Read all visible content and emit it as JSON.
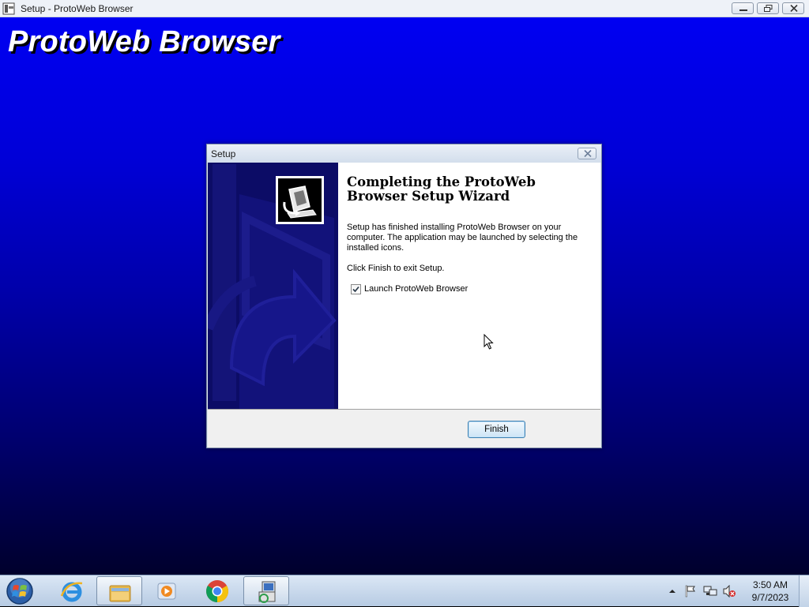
{
  "window": {
    "title": "Setup - ProtoWeb Browser",
    "brand_title": "ProtoWeb Browser"
  },
  "dialog": {
    "title": "Setup",
    "heading": "Completing the ProtoWeb Browser Setup Wizard",
    "message": "Setup has finished installing ProtoWeb Browser on your computer. The application may be launched by selecting the installed icons.",
    "exit_hint": "Click Finish to exit Setup.",
    "launch_checkbox": {
      "label": "Launch ProtoWeb Browser",
      "checked": true
    },
    "finish_label": "Finish"
  },
  "taskbar": {
    "items": [
      "start-orb-icon",
      "internet-explorer-icon",
      "file-explorer-icon",
      "media-player-icon",
      "chrome-icon",
      "setup-installer-icon"
    ],
    "clock": {
      "time": "3:50 AM",
      "date": "9/7/2023"
    }
  },
  "colors": {
    "background_top": "#0000f2",
    "background_bottom": "#00002c",
    "sidebar": "#0c0c66"
  }
}
